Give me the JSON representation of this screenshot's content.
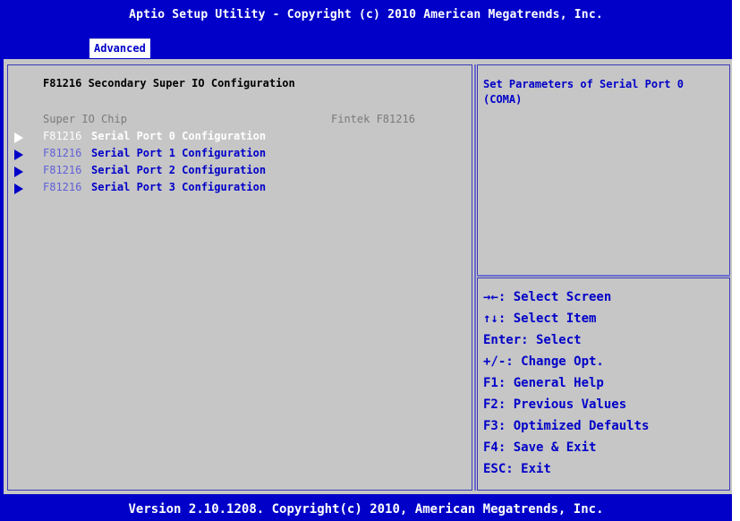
{
  "title": "Aptio Setup Utility - Copyright (c) 2010 American Megatrends, Inc.",
  "tabs": [
    {
      "label": "Advanced",
      "active": true
    }
  ],
  "main": {
    "heading": "F81216 Secondary Super IO Configuration",
    "info": {
      "label": "Super IO Chip",
      "value": "Fintek F81216"
    },
    "items": [
      {
        "prefix": "F81216",
        "label": " Serial Port 0 Configuration",
        "selected": true
      },
      {
        "prefix": "F81216",
        "label": " Serial Port 1 Configuration",
        "selected": false
      },
      {
        "prefix": "F81216",
        "label": " Serial Port 2 Configuration",
        "selected": false
      },
      {
        "prefix": "F81216",
        "label": " Serial Port 3 Configuration",
        "selected": false
      }
    ]
  },
  "help": {
    "text": "Set Parameters of Serial Port 0 (COMA)"
  },
  "keys": [
    "→←: Select Screen",
    "↑↓: Select Item",
    "Enter: Select",
    "+/-: Change Opt.",
    "F1: General Help",
    "F2: Previous Values",
    "F3: Optimized Defaults",
    "F4: Save & Exit",
    "ESC: Exit"
  ],
  "footer": "Version 2.10.1208. Copyright(c) 2010, American Megatrends, Inc.",
  "colors": {
    "frame_blue": "#0000c8",
    "panel_gray": "#c6c6c6",
    "text_blue": "#0000c8",
    "selected_text": "#ffffff",
    "disabled_text": "#7a7a7a"
  }
}
